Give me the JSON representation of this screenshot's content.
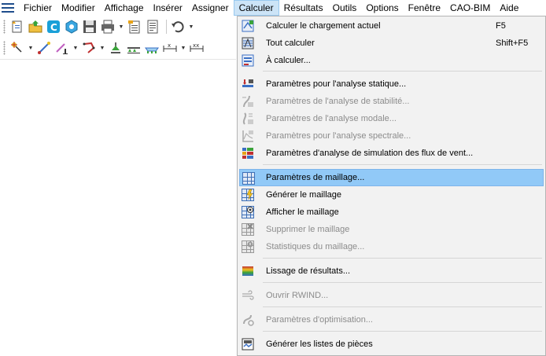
{
  "menubar": {
    "items": [
      {
        "label": "Fichier"
      },
      {
        "label": "Modifier"
      },
      {
        "label": "Affichage"
      },
      {
        "label": "Insérer"
      },
      {
        "label": "Assigner"
      },
      {
        "label": "Calculer"
      },
      {
        "label": "Résultats"
      },
      {
        "label": "Outils"
      },
      {
        "label": "Options"
      },
      {
        "label": "Fenêtre"
      },
      {
        "label": "CAO-BIM"
      },
      {
        "label": "Aide"
      }
    ],
    "active": "Calculer"
  },
  "dropdown": {
    "items": [
      {
        "label": "Calculer le chargement actuel",
        "shortcut": "F5",
        "enabled": true,
        "icon": "calculate-current-icon"
      },
      {
        "label": "Tout calculer",
        "shortcut": "Shift+F5",
        "enabled": true,
        "icon": "calculate-all-icon"
      },
      {
        "label": "À calculer...",
        "shortcut": "",
        "enabled": true,
        "icon": "to-calculate-icon"
      },
      {
        "label": "Paramètres pour l'analyse statique...",
        "shortcut": "",
        "enabled": true,
        "icon": "static-analysis-icon"
      },
      {
        "label": "Paramètres de l'analyse de stabilité...",
        "shortcut": "",
        "enabled": false,
        "icon": "stability-analysis-icon"
      },
      {
        "label": "Paramètres de l'analyse modale...",
        "shortcut": "",
        "enabled": false,
        "icon": "modal-analysis-icon"
      },
      {
        "label": "Paramètres pour l'analyse spectrale...",
        "shortcut": "",
        "enabled": false,
        "icon": "spectral-analysis-icon"
      },
      {
        "label": "Paramètres d'analyse de simulation des flux de vent...",
        "shortcut": "",
        "enabled": true,
        "icon": "wind-simulation-icon"
      },
      {
        "label": "Paramètres de maillage...",
        "shortcut": "",
        "enabled": true,
        "icon": "mesh-settings-icon"
      },
      {
        "label": "Générer le maillage",
        "shortcut": "",
        "enabled": true,
        "icon": "generate-mesh-icon"
      },
      {
        "label": "Afficher le maillage",
        "shortcut": "",
        "enabled": true,
        "icon": "show-mesh-icon"
      },
      {
        "label": "Supprimer le maillage",
        "shortcut": "",
        "enabled": false,
        "icon": "delete-mesh-icon"
      },
      {
        "label": "Statistiques du maillage...",
        "shortcut": "",
        "enabled": false,
        "icon": "mesh-statistics-icon"
      },
      {
        "label": "Lissage de résultats...",
        "shortcut": "",
        "enabled": true,
        "icon": "result-smoothing-icon"
      },
      {
        "label": "Ouvrir RWIND...",
        "shortcut": "",
        "enabled": false,
        "icon": "open-rwind-icon"
      },
      {
        "label": "Paramètres d'optimisation...",
        "shortcut": "",
        "enabled": false,
        "icon": "optimization-icon"
      },
      {
        "label": "Générer les listes de pièces",
        "shortcut": "",
        "enabled": true,
        "icon": "parts-list-icon"
      }
    ],
    "highlighted": "Paramètres de maillage..."
  },
  "colors": {
    "menu_active_bg": "#cce4f7",
    "item_highlight_bg": "#91c9f7",
    "disabled_text": "#8c8c8c"
  }
}
